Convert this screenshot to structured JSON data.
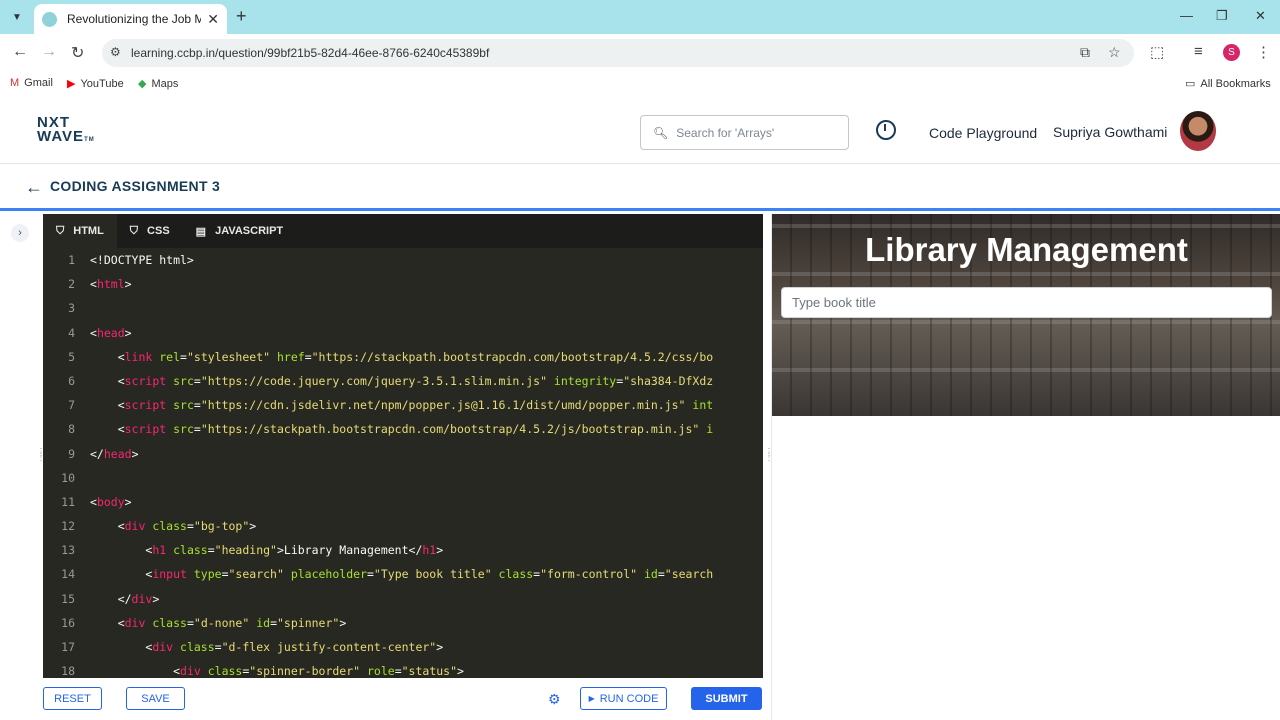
{
  "browser": {
    "tab_title": "Revolutionizing the Job Market",
    "url": "learning.ccbp.in/question/99bf21b5-82d4-46ee-8766-6240c45389bf",
    "profile_initial": "S",
    "bookmarks": [
      "Gmail",
      "YouTube",
      "Maps"
    ],
    "all_bookmarks": "All Bookmarks"
  },
  "header": {
    "logo_line1": "NXT",
    "logo_line2": "WAVE",
    "logo_tm": "TM",
    "search_placeholder": "Search for 'Arrays'",
    "code_playground": "Code Playground",
    "user_name": "Supriya Gowthami"
  },
  "assignment": {
    "title": "CODING ASSIGNMENT 3"
  },
  "editor": {
    "tabs": [
      "HTML",
      "CSS",
      "JAVASCRIPT"
    ],
    "active_tab": "HTML",
    "lines": [
      [
        {
          "t": "<!DOCTYPE html>",
          "c": "txt"
        }
      ],
      [
        {
          "t": "<",
          "c": "txt"
        },
        {
          "t": "html",
          "c": "tag"
        },
        {
          "t": ">",
          "c": "txt"
        }
      ],
      [],
      [
        {
          "t": "<",
          "c": "txt"
        },
        {
          "t": "head",
          "c": "tag"
        },
        {
          "t": ">",
          "c": "txt"
        }
      ],
      [
        {
          "t": "    <",
          "c": "txt"
        },
        {
          "t": "link",
          "c": "tag"
        },
        {
          "t": " rel",
          "c": "attr"
        },
        {
          "t": "=",
          "c": "txt"
        },
        {
          "t": "\"stylesheet\"",
          "c": "str"
        },
        {
          "t": " href",
          "c": "attr"
        },
        {
          "t": "=",
          "c": "txt"
        },
        {
          "t": "\"https://stackpath.bootstrapcdn.com/bootstrap/4.5.2/css/bo",
          "c": "str"
        }
      ],
      [
        {
          "t": "    <",
          "c": "txt"
        },
        {
          "t": "script",
          "c": "tag"
        },
        {
          "t": " src",
          "c": "attr"
        },
        {
          "t": "=",
          "c": "txt"
        },
        {
          "t": "\"https://code.jquery.com/jquery-3.5.1.slim.min.js\"",
          "c": "str"
        },
        {
          "t": " integrity",
          "c": "attr"
        },
        {
          "t": "=",
          "c": "txt"
        },
        {
          "t": "\"sha384-DfXdz",
          "c": "str"
        }
      ],
      [
        {
          "t": "    <",
          "c": "txt"
        },
        {
          "t": "script",
          "c": "tag"
        },
        {
          "t": " src",
          "c": "attr"
        },
        {
          "t": "=",
          "c": "txt"
        },
        {
          "t": "\"https://cdn.jsdelivr.net/npm/popper.js@1.16.1/dist/umd/popper.min.js\"",
          "c": "str"
        },
        {
          "t": " int",
          "c": "attr"
        }
      ],
      [
        {
          "t": "    <",
          "c": "txt"
        },
        {
          "t": "script",
          "c": "tag"
        },
        {
          "t": " src",
          "c": "attr"
        },
        {
          "t": "=",
          "c": "txt"
        },
        {
          "t": "\"https://stackpath.bootstrapcdn.com/bootstrap/4.5.2/js/bootstrap.min.js\"",
          "c": "str"
        },
        {
          "t": " i",
          "c": "attr"
        }
      ],
      [
        {
          "t": "</",
          "c": "txt"
        },
        {
          "t": "head",
          "c": "tag"
        },
        {
          "t": ">",
          "c": "txt"
        }
      ],
      [],
      [
        {
          "t": "<",
          "c": "txt"
        },
        {
          "t": "body",
          "c": "tag"
        },
        {
          "t": ">",
          "c": "txt"
        }
      ],
      [
        {
          "t": "    <",
          "c": "txt"
        },
        {
          "t": "div",
          "c": "tag"
        },
        {
          "t": " class",
          "c": "attr"
        },
        {
          "t": "=",
          "c": "txt"
        },
        {
          "t": "\"bg-top\"",
          "c": "str"
        },
        {
          "t": ">",
          "c": "txt"
        }
      ],
      [
        {
          "t": "        <",
          "c": "txt"
        },
        {
          "t": "h1",
          "c": "tag"
        },
        {
          "t": " class",
          "c": "attr"
        },
        {
          "t": "=",
          "c": "txt"
        },
        {
          "t": "\"heading\"",
          "c": "str"
        },
        {
          "t": ">Library Management</",
          "c": "txt"
        },
        {
          "t": "h1",
          "c": "tag"
        },
        {
          "t": ">",
          "c": "txt"
        }
      ],
      [
        {
          "t": "        <",
          "c": "txt"
        },
        {
          "t": "input",
          "c": "tag"
        },
        {
          "t": " type",
          "c": "attr"
        },
        {
          "t": "=",
          "c": "txt"
        },
        {
          "t": "\"search\"",
          "c": "str"
        },
        {
          "t": " placeholder",
          "c": "attr"
        },
        {
          "t": "=",
          "c": "txt"
        },
        {
          "t": "\"Type book title\"",
          "c": "str"
        },
        {
          "t": " class",
          "c": "attr"
        },
        {
          "t": "=",
          "c": "txt"
        },
        {
          "t": "\"form-control\"",
          "c": "str"
        },
        {
          "t": " id",
          "c": "attr"
        },
        {
          "t": "=",
          "c": "txt"
        },
        {
          "t": "\"search",
          "c": "str"
        }
      ],
      [
        {
          "t": "    </",
          "c": "txt"
        },
        {
          "t": "div",
          "c": "tag"
        },
        {
          "t": ">",
          "c": "txt"
        }
      ],
      [
        {
          "t": "    <",
          "c": "txt"
        },
        {
          "t": "div",
          "c": "tag"
        },
        {
          "t": " class",
          "c": "attr"
        },
        {
          "t": "=",
          "c": "txt"
        },
        {
          "t": "\"d-none\"",
          "c": "str"
        },
        {
          "t": " id",
          "c": "attr"
        },
        {
          "t": "=",
          "c": "txt"
        },
        {
          "t": "\"spinner\"",
          "c": "str"
        },
        {
          "t": ">",
          "c": "txt"
        }
      ],
      [
        {
          "t": "        <",
          "c": "txt"
        },
        {
          "t": "div",
          "c": "tag"
        },
        {
          "t": " class",
          "c": "attr"
        },
        {
          "t": "=",
          "c": "txt"
        },
        {
          "t": "\"d-flex justify-content-center\"",
          "c": "str"
        },
        {
          "t": ">",
          "c": "txt"
        }
      ],
      [
        {
          "t": "            <",
          "c": "txt"
        },
        {
          "t": "div",
          "c": "tag"
        },
        {
          "t": " class",
          "c": "attr"
        },
        {
          "t": "=",
          "c": "txt"
        },
        {
          "t": "\"spinner-border\"",
          "c": "str"
        },
        {
          "t": " role",
          "c": "attr"
        },
        {
          "t": "=",
          "c": "txt"
        },
        {
          "t": "\"status\"",
          "c": "str"
        },
        {
          "t": ">",
          "c": "txt"
        }
      ]
    ]
  },
  "actions": {
    "reset": "RESET",
    "save": "SAVE",
    "run_code": "RUN CODE",
    "submit": "SUBMIT"
  },
  "preview": {
    "heading": "Library Management",
    "search_placeholder": "Type book title"
  },
  "colors": {
    "accent": "#2563eb",
    "brand_dark": "#183b56",
    "editor_bg": "#272822",
    "tabbar_bg": "#a8e2ea"
  }
}
